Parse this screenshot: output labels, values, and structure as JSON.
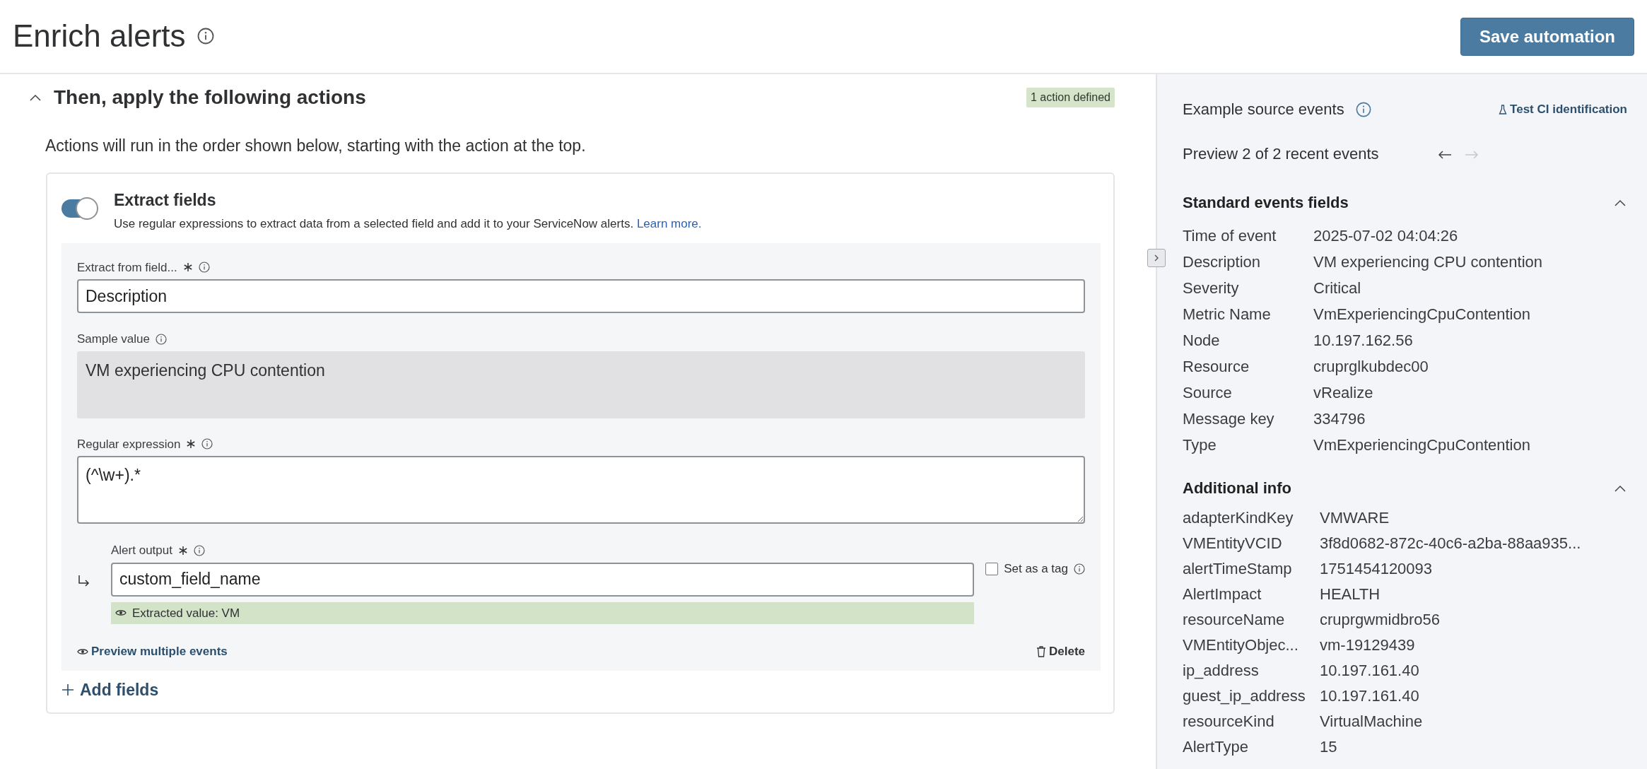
{
  "header": {
    "title": "Enrich alerts",
    "save_button": "Save automation"
  },
  "section": {
    "title": "Then, apply the following actions",
    "expanded": true,
    "badge": "1 action defined",
    "description": "Actions will run in the order shown below, starting with the action at the top."
  },
  "action": {
    "on": true,
    "title": "Extract fields",
    "description": "Use regular expressions to extract data from a selected field and add it to your ServiceNow alerts.",
    "learn_more": "Learn more.",
    "extract_from": {
      "label": "Extract from field...",
      "value": "Description"
    },
    "sample": {
      "label": "Sample value",
      "value": "VM experiencing CPU contention"
    },
    "regex": {
      "label": "Regular expression",
      "value": "(^\\w+).*"
    },
    "output": {
      "label": "Alert output",
      "value": "custom_field_name",
      "extracted": "Extracted value: VM"
    },
    "tag": {
      "label": "Set as a tag",
      "checked": false
    },
    "preview_link": "Preview multiple events",
    "delete_button": "Delete"
  },
  "add_fields": "Add fields",
  "side_panel": {
    "title": "Example source events",
    "test_link": "Test CI identification",
    "preview": "Preview 2 of 2 recent events",
    "prev_disabled": false,
    "next_disabled": true,
    "groups": [
      {
        "title": "Standard events fields",
        "expanded": true,
        "rows": [
          {
            "key": "Time of event",
            "value": "2025-07-02 04:04:26"
          },
          {
            "key": "Description",
            "value": "VM experiencing CPU contention"
          },
          {
            "key": "Severity",
            "value": "Critical"
          },
          {
            "key": "Metric Name",
            "value": "VmExperiencingCpuContention"
          },
          {
            "key": "Node",
            "value": "10.197.162.56"
          },
          {
            "key": "Resource",
            "value": "cruprglkubdec00"
          },
          {
            "key": "Source",
            "value": "vRealize"
          },
          {
            "key": "Message key",
            "value": "334796"
          },
          {
            "key": "Type",
            "value": "VmExperiencingCpuContention"
          }
        ]
      },
      {
        "title": "Additional info",
        "expanded": true,
        "rows": [
          {
            "key": "adapterKindKey",
            "value": "VMWARE"
          },
          {
            "key": "VMEntityVCID",
            "value": "3f8d0682-872c-40c6-a2ba-88aa935..."
          },
          {
            "key": "alertTimeStamp",
            "value": "1751454120093"
          },
          {
            "key": "AlertImpact",
            "value": "HEALTH"
          },
          {
            "key": "resourceName",
            "value": "cruprgwmidbro56"
          },
          {
            "key": "VMEntityObjec...",
            "value": "vm-19129439"
          },
          {
            "key": "ip_address",
            "value": "10.197.161.40"
          },
          {
            "key": "guest_ip_address",
            "value": "10.197.161.40"
          },
          {
            "key": "resourceKind",
            "value": "VirtualMachine"
          },
          {
            "key": "AlertType",
            "value": "15"
          }
        ]
      }
    ]
  }
}
